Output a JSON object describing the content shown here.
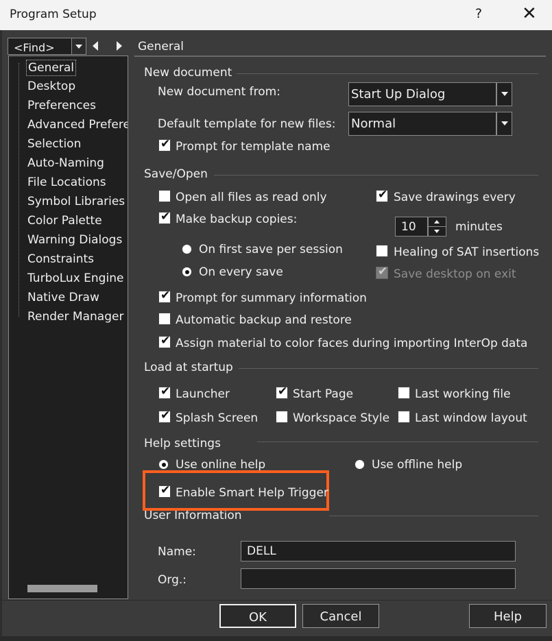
{
  "window": {
    "title": "Program Setup",
    "help_glyph": "?",
    "close_glyph": "✕"
  },
  "nav": {
    "find_value": "<Find>",
    "tree_items": [
      "General",
      "Desktop",
      "Preferences",
      "Advanced Preferen",
      "Selection",
      "Auto-Naming",
      "File Locations",
      "Symbol Libraries",
      "Color Palette",
      "Warning Dialogs",
      "Constraints",
      "TurboLux Engine",
      "Native Draw",
      "Render Manager"
    ],
    "selected": "General"
  },
  "page": {
    "header": "General"
  },
  "new_document": {
    "title": "New document",
    "from_label": "New document from:",
    "from_value": "Start Up Dialog",
    "template_label": "Default template for new files:",
    "template_value": "Normal",
    "prompt_template_label": "Prompt for template name",
    "prompt_template_checked": true
  },
  "save_open": {
    "title": "Save/Open",
    "read_only_label": "Open all files as read only",
    "read_only_checked": false,
    "backup_label": "Make backup copies:",
    "backup_checked": true,
    "first_save_label": "On first save per session",
    "every_save_label": "On every save",
    "backup_mode": "every_save",
    "save_every_label": "Save drawings every",
    "save_every_checked": true,
    "minutes_value": "10",
    "minutes_label": "minutes",
    "healing_label": "Healing of SAT insertions",
    "healing_checked": false,
    "save_desktop_label": "Save desktop on exit",
    "save_desktop_checked": true,
    "save_desktop_enabled": false,
    "summary_label": "Prompt for summary information",
    "summary_checked": true,
    "auto_backup_label": "Automatic backup and restore",
    "auto_backup_checked": false,
    "assign_material_label": "Assign material to color faces during importing InterOp data",
    "assign_material_checked": true
  },
  "startup": {
    "title": "Load at startup",
    "launcher_label": "Launcher",
    "launcher_checked": true,
    "start_page_label": "Start Page",
    "start_page_checked": true,
    "last_file_label": "Last working file",
    "last_file_checked": false,
    "splash_label": "Splash Screen",
    "splash_checked": true,
    "workspace_label": "Workspace Style",
    "workspace_checked": false,
    "last_layout_label": "Last window layout",
    "last_layout_checked": false
  },
  "help": {
    "title": "Help settings",
    "online_label": "Use online help",
    "offline_label": "Use offline help",
    "mode": "online",
    "smart_trigger_label": "Enable Smart Help Trigger",
    "smart_trigger_checked": true
  },
  "user": {
    "title": "User Information",
    "name_label": "Name:",
    "name_value": "DELL",
    "org_label": "Org.:",
    "org_value": ""
  },
  "footer": {
    "ok": "OK",
    "cancel": "Cancel",
    "help": "Help"
  },
  "colors": {
    "background": "#3b3b3b",
    "field": "#1f1f1f",
    "highlight": "#ff5f1f"
  }
}
